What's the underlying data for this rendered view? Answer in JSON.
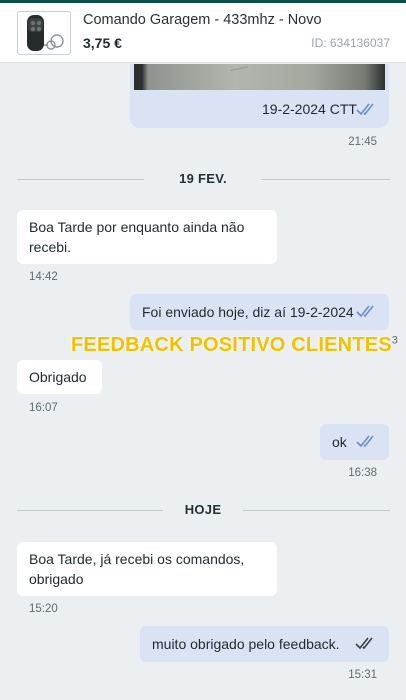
{
  "header": {
    "title": "Comando Garagem - 433mhz - Novo",
    "price": "3,75 €",
    "id_label": "ID: 634136037",
    "thumbnail_icon": "remote-control-icon"
  },
  "messages": {
    "m1": {
      "text": "19-2-2024 CTT",
      "time": "21:45",
      "status": "read-double-check"
    },
    "sep1": "19 FEV.",
    "m2": {
      "line1": "Boa Tarde  por enquanto ainda não",
      "line2": "recebi.",
      "time": "14:42"
    },
    "m3": {
      "text": "Foi enviado hoje, diz aí 19-2-2024",
      "status": "read-double-check"
    },
    "m4": {
      "text": "Obrigado",
      "time": "16:07"
    },
    "m5": {
      "text": "ok",
      "time": "16:38",
      "status": "read-double-check"
    },
    "sep2": "HOJE",
    "m6": {
      "line1": "Boa Tarde, já recebi os comandos,",
      "line2": "obrigado",
      "time": "15:20"
    },
    "m7": {
      "text": "muito obrigado pelo feedback.",
      "time": "15:31",
      "status": "sent-double-check"
    }
  },
  "watermark": {
    "text": "FEEDBACK POSITIVO CLIENTES",
    "suffix": "3"
  },
  "colors": {
    "incoming_bubble": "#ffffff",
    "outgoing_bubble": "#d9e3f4",
    "read_check": "#6d8fc4",
    "watermark": "#f2c200"
  }
}
